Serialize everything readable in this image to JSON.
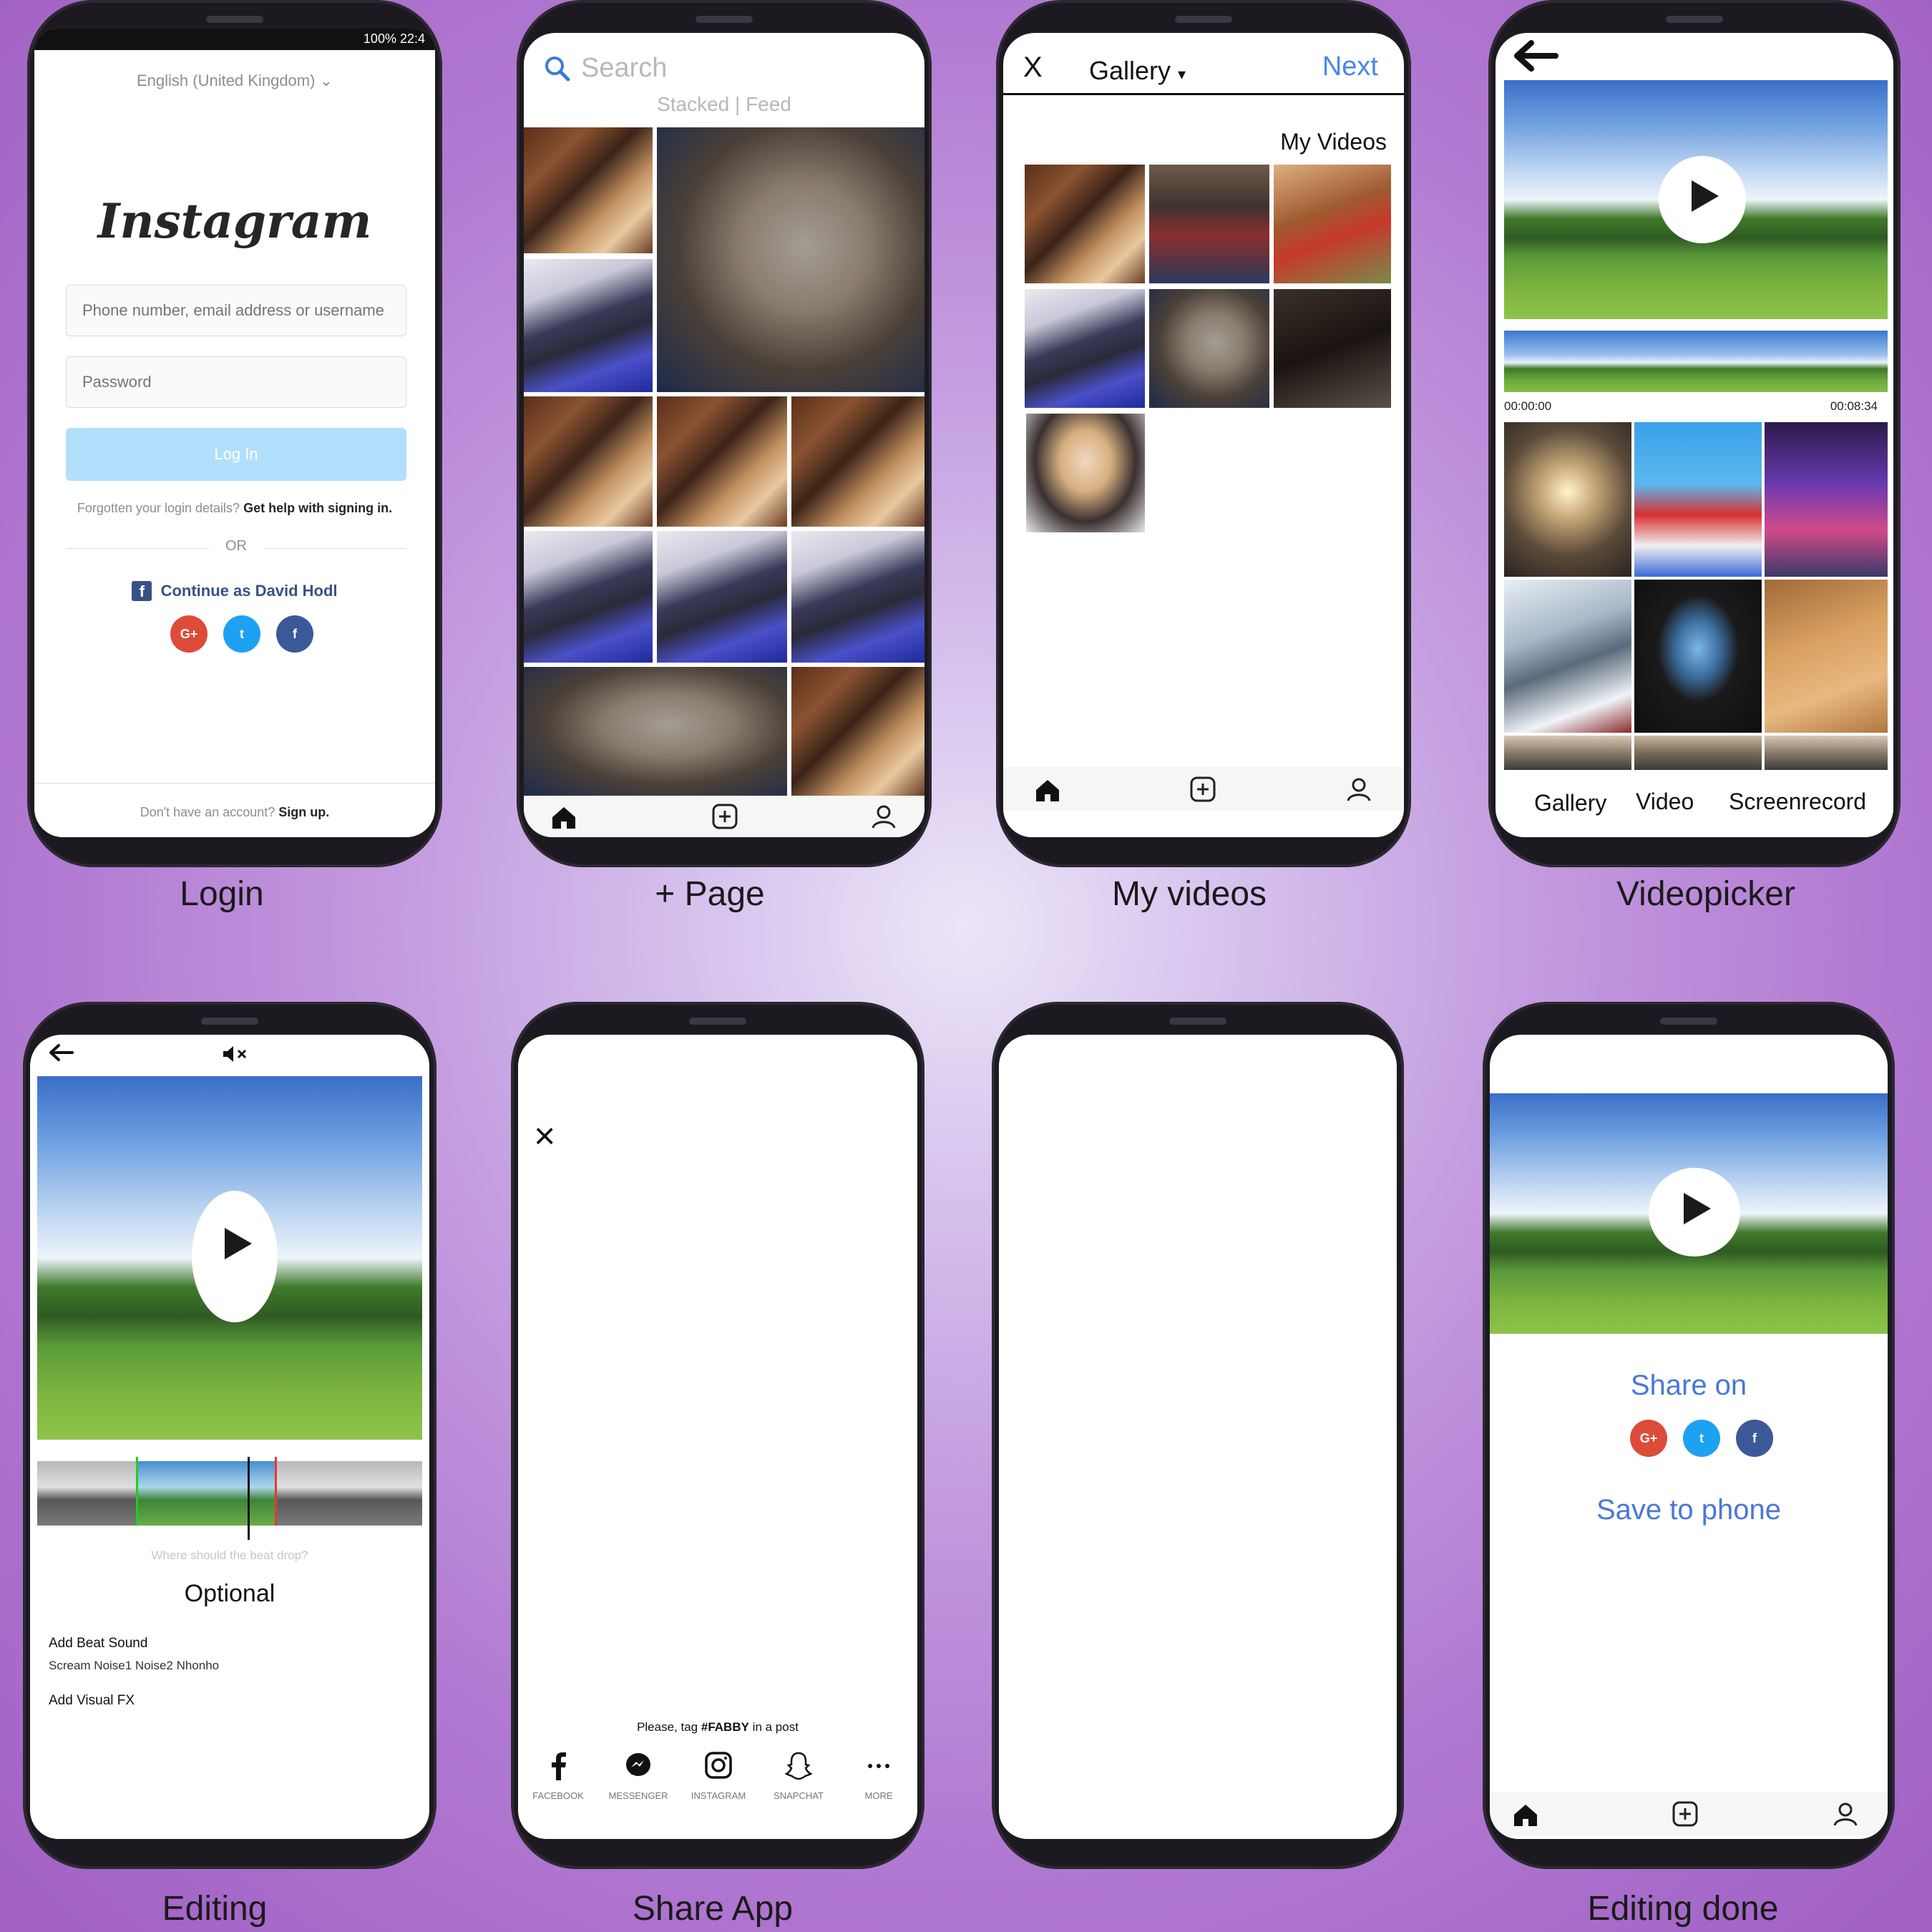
{
  "captions": {
    "login": "Login",
    "plus_page": "+ Page",
    "my_videos": "My videos",
    "videopicker": "Videopicker",
    "editing": "Editing",
    "share_app": "Share App",
    "editing_done": "Editing done"
  },
  "login": {
    "status_text": "100% 22:4",
    "language": "English (United Kingdom)",
    "logo": "Instagram",
    "username_placeholder": "Phone number, email address or username",
    "password_placeholder": "Password",
    "login_button": "Log In",
    "forgot_text": "Forgotten your login details?",
    "help_link": "Get help with signing in.",
    "or_text": "OR",
    "continue_fb": "Continue as David Hodl",
    "social": [
      "G+",
      "t",
      "f"
    ],
    "signup_prompt": "Don't have an account?",
    "signup_link": "Sign up.",
    "colors": {
      "primary": "#3897f0",
      "login_disabled": "#b2dffc",
      "fb": "#385185",
      "gplus": "#dd4b39",
      "twitter": "#1da1f2"
    }
  },
  "plus_page": {
    "search_placeholder": "Search",
    "view_toggle": "Stacked | Feed"
  },
  "my_videos": {
    "close": "X",
    "gallery_label": "Gallery",
    "next": "Next",
    "section_title": "My Videos"
  },
  "videopicker": {
    "time_start": "00:00:00",
    "time_end": "00:08:34",
    "tabs": [
      "Gallery",
      "Video",
      "Screenrecord"
    ]
  },
  "editing": {
    "beat_hint": "Where should the beat drop?",
    "optional_title": "Optional",
    "add_beat_label": "Add Beat Sound",
    "beat_options": "Scream Noise1 Noise2 Nhonho",
    "add_fx_label": "Add Visual FX"
  },
  "share_app": {
    "close": "×",
    "tag_prefix": "Please, tag",
    "tag_hashtag": "#FABBY",
    "tag_suffix": "in a post",
    "targets": [
      {
        "label": "FACEBOOK",
        "icon": "facebook-icon"
      },
      {
        "label": "MESSENGER",
        "icon": "messenger-icon"
      },
      {
        "label": "INSTAGRAM",
        "icon": "instagram-icon"
      },
      {
        "label": "SNAPCHAT",
        "icon": "snapchat-icon"
      },
      {
        "label": "MORE",
        "icon": "more-icon"
      }
    ]
  },
  "editing_done": {
    "share_on": "Share on",
    "save_to_phone": "Save to phone",
    "link_color": "#4a78d8"
  }
}
